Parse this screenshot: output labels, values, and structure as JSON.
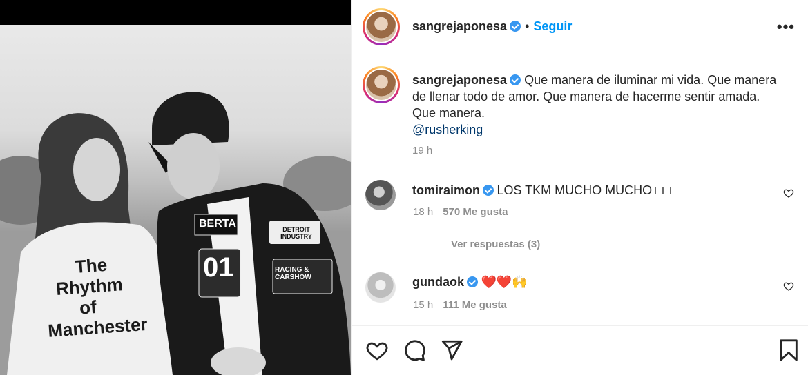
{
  "post": {
    "username": "sangrejaponesa",
    "follow_label": "Seguir",
    "dot": "•",
    "more_label": "•••"
  },
  "photo_text": {
    "shirt_lines": [
      "The",
      "Rhythm",
      "of",
      "Manchester"
    ],
    "badge_number": "01",
    "badge_brand": "BERTA",
    "badge_detroit": "DETROIT INDUSTRY",
    "badge_racing": "RACING & CARSHOW"
  },
  "caption": {
    "username": "sangrejaponesa",
    "text": "Que manera de iluminar mi vida. Que manera de llenar todo de amor. Que manera de hacerme sentir amada. Que manera.",
    "mention": "@rusherking",
    "time": "19 h"
  },
  "comments": [
    {
      "username": "tomiraimon",
      "text": "LOS TKM MUCHO MUCHO □□",
      "time": "18 h",
      "likes": "570 Me gusta"
    },
    {
      "username": "gundaok",
      "text": "❤️❤️🙌",
      "time": "15 h",
      "likes": "111 Me gusta"
    }
  ],
  "replies_label": "Ver respuestas (3)",
  "icons": {
    "like": "heart-icon",
    "comment": "comment-icon",
    "share": "share-icon",
    "save": "bookmark-icon",
    "verified": "verified-badge-icon",
    "comment_like": "heart-outline-icon"
  },
  "colors": {
    "accent": "#0095f6",
    "verified": "#3897f0",
    "mention": "#00376b",
    "muted": "#8e8e8e"
  }
}
